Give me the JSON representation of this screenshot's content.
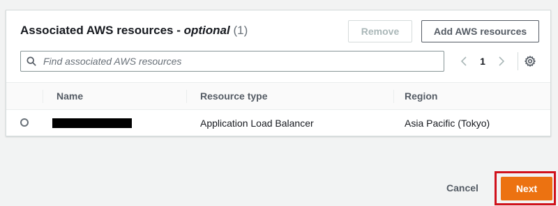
{
  "panel": {
    "title": "Associated AWS resources - ",
    "title_optional": "optional",
    "count": "(1)",
    "remove_label": "Remove",
    "add_label": "Add AWS resources"
  },
  "search": {
    "placeholder": "Find associated AWS resources",
    "value": ""
  },
  "pagination": {
    "current_page": "1",
    "prev_icon": "chevron-left-icon",
    "next_icon": "chevron-right-icon",
    "settings_icon": "gear-icon"
  },
  "table": {
    "columns": [
      "Name",
      "Resource type",
      "Region"
    ],
    "rows": [
      {
        "name": "",
        "resource_type": "Application Load Balancer",
        "region": "Asia Pacific (Tokyo)"
      }
    ]
  },
  "footer": {
    "cancel_label": "Cancel",
    "next_label": "Next",
    "primary_color": "#ec7211",
    "highlight_color": "#d0111b"
  }
}
